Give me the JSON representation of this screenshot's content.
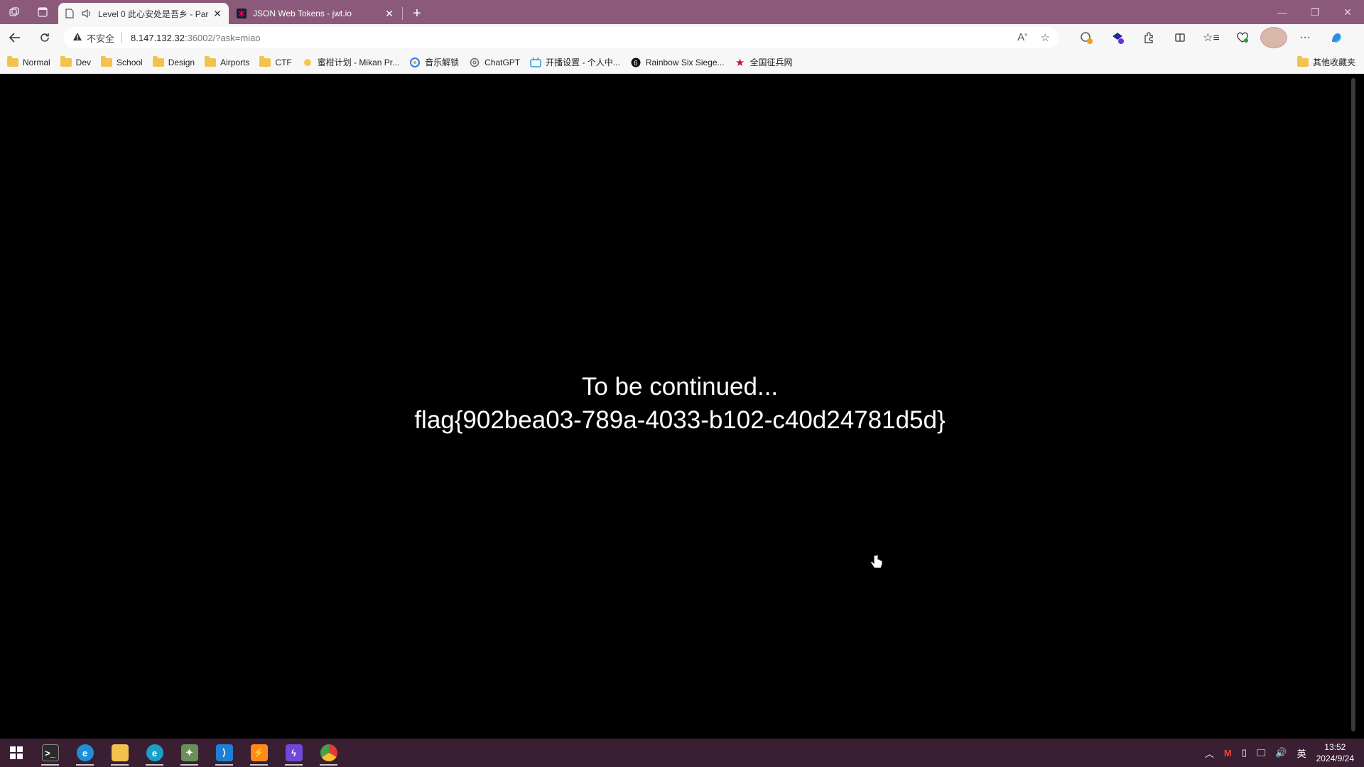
{
  "browser": {
    "tabs": [
      {
        "title": "Level 0 此心安处是吾乡 - Par",
        "active": true,
        "audio": true
      },
      {
        "title": "JSON Web Tokens - jwt.io",
        "active": false
      }
    ],
    "address": {
      "security_label": "不安全",
      "host": "8.147.132.32",
      "path": ":36002/?ask=miao"
    },
    "bookmarks": [
      {
        "label": "Normal",
        "icon": "folder-icon"
      },
      {
        "label": "Dev",
        "icon": "folder-icon"
      },
      {
        "label": "School",
        "icon": "folder-icon"
      },
      {
        "label": "Design",
        "icon": "folder-icon"
      },
      {
        "label": "Airports",
        "icon": "folder-icon"
      },
      {
        "label": "CTF",
        "icon": "folder-icon"
      },
      {
        "label": "蜜柑计划 - Mikan Pr...",
        "icon": "mikan-icon"
      },
      {
        "label": "音乐解锁",
        "icon": "music-unlock-icon"
      },
      {
        "label": "ChatGPT",
        "icon": "chatgpt-icon"
      },
      {
        "label": "开播设置 - 个人中...",
        "icon": "bilibili-icon"
      },
      {
        "label": "Rainbow Six Siege...",
        "icon": "r6-icon"
      },
      {
        "label": "全国征兵网",
        "icon": "star-icon"
      }
    ],
    "other_bookmarks": "其他收藏夹"
  },
  "page": {
    "line1": "To be continued...",
    "line2": "flag{902bea03-789a-4033-b102-c40d24781d5d}"
  },
  "taskbar": {
    "time": "13:52",
    "date": "2024/9/24",
    "ime": "英"
  },
  "colors": {
    "titlebar": "#8b5a7a",
    "taskbar": "#3a1f33",
    "page_bg": "#000000",
    "page_text": "#ffffff"
  }
}
